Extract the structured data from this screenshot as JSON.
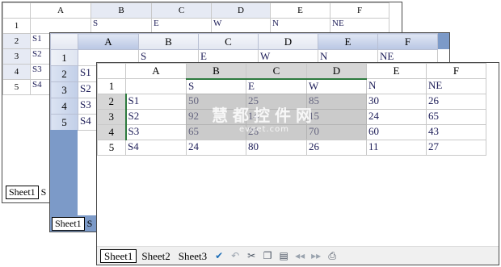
{
  "column_headers": [
    "A",
    "B",
    "C",
    "D",
    "E",
    "F"
  ],
  "row_headers": [
    "1",
    "2",
    "3",
    "4",
    "5"
  ],
  "rows": [
    [
      "",
      "S",
      "E",
      "W",
      "N",
      "NE"
    ],
    [
      "S1",
      "50",
      "25",
      "85",
      "30",
      "26"
    ],
    [
      "S2",
      "92",
      "14",
      "15",
      "24",
      "65"
    ],
    [
      "S3",
      "65",
      "26",
      "70",
      "60",
      "43"
    ],
    [
      "S4",
      "24",
      "80",
      "26",
      "11",
      "27"
    ]
  ],
  "sheet_tabs": [
    "Sheet1",
    "Sheet2",
    "Sheet3"
  ],
  "back_window": {
    "partial_tab": "S"
  },
  "middle_window": {
    "partial_tab": "S"
  },
  "toolbar_icons": [
    "check-icon",
    "undo-icon",
    "cut-icon",
    "copy-icon",
    "paste-icon",
    "first-page-icon",
    "last-page-icon",
    "print-icon"
  ],
  "watermark": {
    "title": "慧都控件网",
    "url": "evget.com"
  },
  "colors": {
    "header_blue": "#7c9ac8",
    "selection_gray": "#d6d6d6",
    "selection_border": "#2d7a3e",
    "cell_text": "#20205a"
  }
}
